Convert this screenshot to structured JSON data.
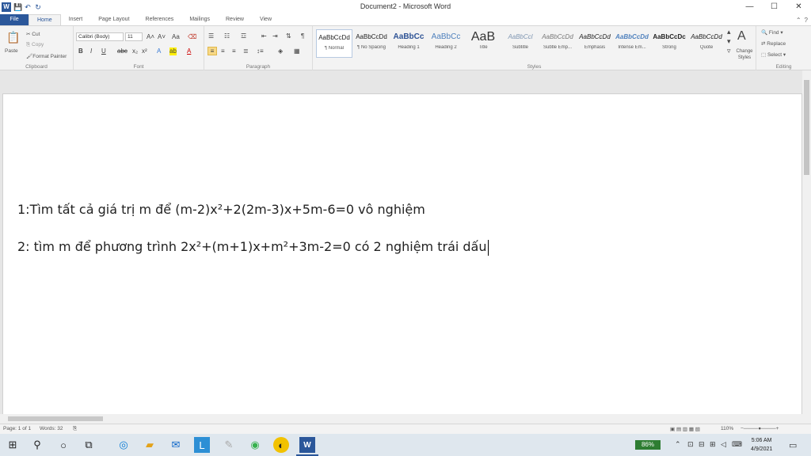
{
  "window": {
    "title": "Document2 - Microsoft Word",
    "app_icon": "W",
    "colors": {
      "accent": "#2b579a",
      "ribbon_bg": "#f3f3f3",
      "battery": "#2e7d32"
    }
  },
  "qat": {
    "save_icon": "💾",
    "undo_icon": "↶",
    "redo_icon": "↻"
  },
  "controls": {
    "minimize": "—",
    "maximize": "☐",
    "close": "✕"
  },
  "tabs": [
    "File",
    "Home",
    "Insert",
    "Page Layout",
    "References",
    "Mailings",
    "Review",
    "View"
  ],
  "ribbon": {
    "clipboard": {
      "label": "Clipboard",
      "paste": "Paste",
      "cut": "Cut",
      "copy": "Copy",
      "format_painter": "Format Painter"
    },
    "font": {
      "label": "Font",
      "font_name": "Calibri (Body)",
      "font_size": "11",
      "bold": "B",
      "italic": "I",
      "underline": "U"
    },
    "paragraph": {
      "label": "Paragraph"
    },
    "styles": {
      "label": "Styles",
      "items": [
        {
          "sample": "AaBbCcDd",
          "name": "¶ Normal"
        },
        {
          "sample": "AaBbCcDd",
          "name": "¶ No Spacing"
        },
        {
          "sample": "AaBbCc",
          "name": "Heading 1"
        },
        {
          "sample": "AaBbCc",
          "name": "Heading 2"
        },
        {
          "sample": "AaB",
          "name": "Title"
        },
        {
          "sample": "AaBbCcl",
          "name": "Subtitle"
        },
        {
          "sample": "AaBbCcDd",
          "name": "Subtle Emp..."
        },
        {
          "sample": "AaBbCcDd",
          "name": "Emphasis"
        },
        {
          "sample": "AaBbCcDd",
          "name": "Intense Em..."
        },
        {
          "sample": "AaBbCcDc",
          "name": "Strong"
        },
        {
          "sample": "AaBbCcDd",
          "name": "Quote"
        }
      ],
      "change_styles": "Change Styles"
    },
    "editing": {
      "label": "Editing",
      "find": "Find",
      "replace": "Replace",
      "select": "Select"
    }
  },
  "document": {
    "line1": "1:Tìm tất cả giá trị  m để (m-2)x²+2(2m-3)x+5m-6=0 vô nghiệm",
    "line2": "2: tìm m để phương trình 2x²+(m+1)x+m²+3m-2=0 có 2 nghiệm trái dấu"
  },
  "status": {
    "page": "Page: 1 of 1",
    "words": "Words: 32",
    "zoom": "110%"
  },
  "taskbar": {
    "battery": "86%",
    "time": "5:06 AM",
    "date": "4/9/2021"
  }
}
